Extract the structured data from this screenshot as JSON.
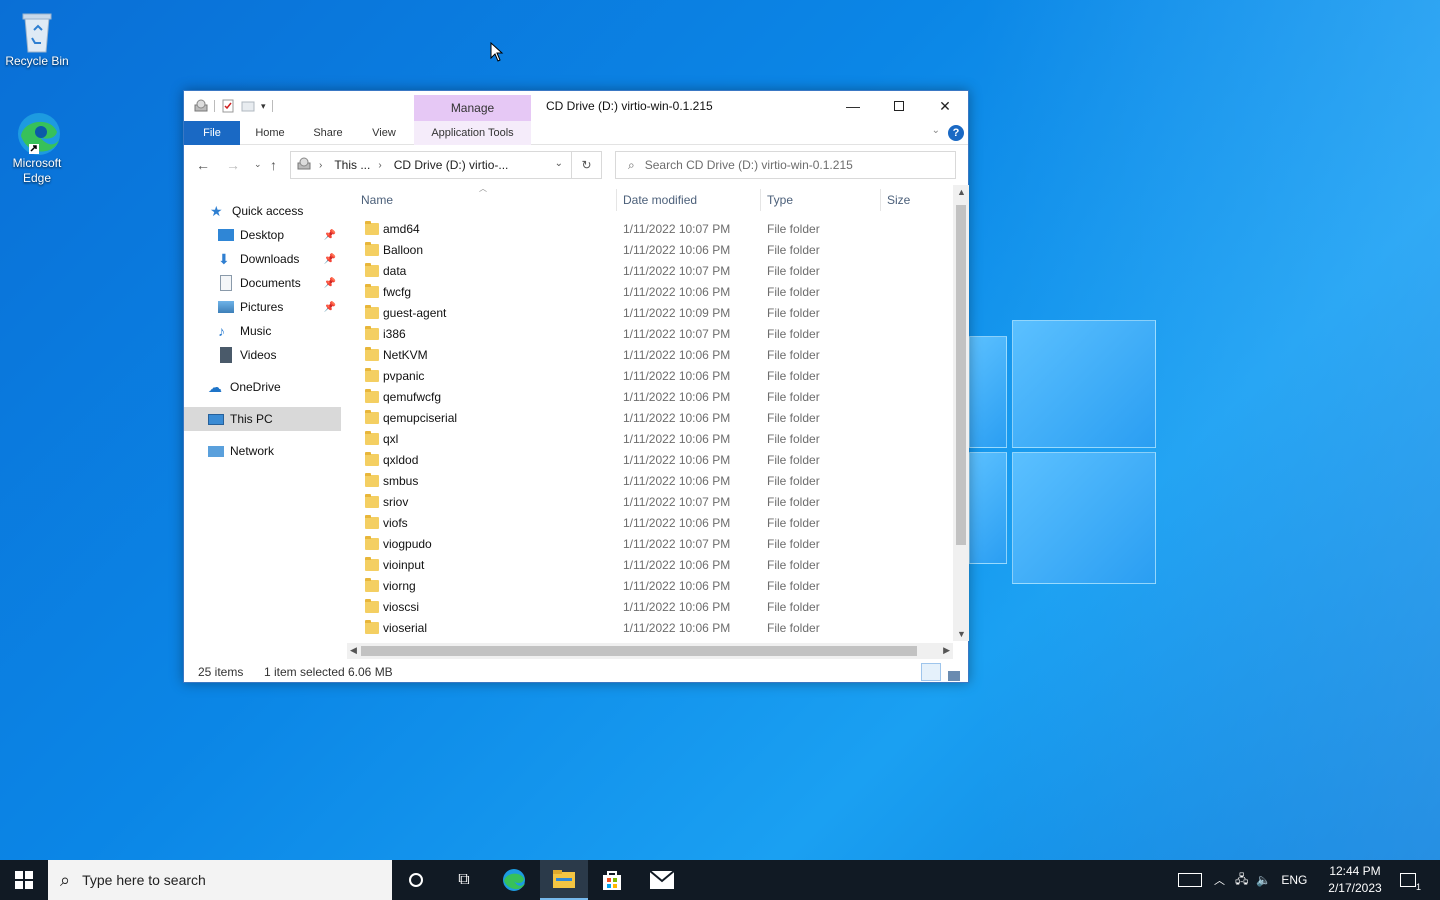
{
  "desktop": {
    "icons": [
      {
        "label": "Recycle Bin"
      },
      {
        "label": "Microsoft Edge"
      }
    ]
  },
  "window": {
    "title": "CD Drive (D:) virtio-win-0.1.215",
    "contextual_tab": "Manage",
    "ribbon_tabs": [
      "File",
      "Home",
      "Share",
      "View",
      "Application Tools"
    ],
    "address": {
      "crumbs": [
        "This ...",
        "CD Drive (D:) virtio-..."
      ]
    },
    "search_placeholder": "Search CD Drive (D:) virtio-win-0.1.215",
    "nav": {
      "quick_access": "Quick access",
      "desktop": "Desktop",
      "downloads": "Downloads",
      "documents": "Documents",
      "pictures": "Pictures",
      "music": "Music",
      "videos": "Videos",
      "onedrive": "OneDrive",
      "this_pc": "This PC",
      "network": "Network"
    },
    "columns": {
      "name": "Name",
      "date": "Date modified",
      "type": "Type",
      "size": "Size"
    },
    "files": [
      {
        "name": "amd64",
        "date": "1/11/2022 10:07 PM",
        "type": "File folder"
      },
      {
        "name": "Balloon",
        "date": "1/11/2022 10:06 PM",
        "type": "File folder"
      },
      {
        "name": "data",
        "date": "1/11/2022 10:07 PM",
        "type": "File folder"
      },
      {
        "name": "fwcfg",
        "date": "1/11/2022 10:06 PM",
        "type": "File folder"
      },
      {
        "name": "guest-agent",
        "date": "1/11/2022 10:09 PM",
        "type": "File folder"
      },
      {
        "name": "i386",
        "date": "1/11/2022 10:07 PM",
        "type": "File folder"
      },
      {
        "name": "NetKVM",
        "date": "1/11/2022 10:06 PM",
        "type": "File folder"
      },
      {
        "name": "pvpanic",
        "date": "1/11/2022 10:06 PM",
        "type": "File folder"
      },
      {
        "name": "qemufwcfg",
        "date": "1/11/2022 10:06 PM",
        "type": "File folder"
      },
      {
        "name": "qemupciserial",
        "date": "1/11/2022 10:06 PM",
        "type": "File folder"
      },
      {
        "name": "qxl",
        "date": "1/11/2022 10:06 PM",
        "type": "File folder"
      },
      {
        "name": "qxldod",
        "date": "1/11/2022 10:06 PM",
        "type": "File folder"
      },
      {
        "name": "smbus",
        "date": "1/11/2022 10:06 PM",
        "type": "File folder"
      },
      {
        "name": "sriov",
        "date": "1/11/2022 10:07 PM",
        "type": "File folder"
      },
      {
        "name": "viofs",
        "date": "1/11/2022 10:06 PM",
        "type": "File folder"
      },
      {
        "name": "viogpudo",
        "date": "1/11/2022 10:07 PM",
        "type": "File folder"
      },
      {
        "name": "vioinput",
        "date": "1/11/2022 10:06 PM",
        "type": "File folder"
      },
      {
        "name": "viorng",
        "date": "1/11/2022 10:06 PM",
        "type": "File folder"
      },
      {
        "name": "vioscsi",
        "date": "1/11/2022 10:06 PM",
        "type": "File folder"
      },
      {
        "name": "vioserial",
        "date": "1/11/2022 10:06 PM",
        "type": "File folder"
      }
    ],
    "status": {
      "items": "25 items",
      "selected": "1 item selected",
      "size": "6.06 MB"
    }
  },
  "taskbar": {
    "search_placeholder": "Type here to search",
    "language": "ENG",
    "time": "12:44 PM",
    "date": "2/17/2023",
    "notification_count": "1"
  },
  "colors": {
    "accent": "#1a69c4",
    "manage_tab": "#e6c8f5",
    "taskbar": "#111a24"
  }
}
